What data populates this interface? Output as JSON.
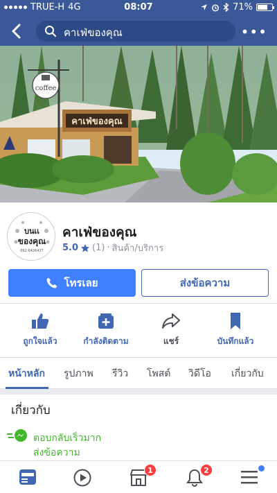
{
  "status": {
    "carrier": "TRUE-H",
    "network": "4G",
    "time": "08:07",
    "battery_percent": "71%",
    "battery_level": 0.71
  },
  "header": {
    "search_text": "คาเฟ่ของคุณ",
    "more_label": "•••"
  },
  "cover": {
    "sign_text": "คาเฟ่ของคุณ",
    "logo_text": "coffee"
  },
  "page": {
    "name": "คาเฟ่ของคุณ",
    "rating": "5.0",
    "rating_count": "(1)",
    "separator": "·",
    "category": "สินค้า/บริการ",
    "avatar_text_line1": "บนเเ",
    "avatar_text_line2": "ของคุณ",
    "avatar_phone": "062 6426437"
  },
  "buttons": {
    "call": "โทรเลย",
    "message": "ส่งข้อความ"
  },
  "actions": [
    {
      "label": "ถูกใจแล้ว",
      "icon": "thumbs-up-icon"
    },
    {
      "label": "กำลังติดตาม",
      "icon": "following-icon"
    },
    {
      "label": "แชร์",
      "icon": "share-icon"
    },
    {
      "label": "บันทึกแล้ว",
      "icon": "bookmark-icon"
    }
  ],
  "tabs": [
    {
      "label": "หน้าหลัก",
      "active": true
    },
    {
      "label": "รูปภาพ",
      "active": false
    },
    {
      "label": "รีวิว",
      "active": false
    },
    {
      "label": "โพสต์",
      "active": false
    },
    {
      "label": "วิดีโอ",
      "active": false
    },
    {
      "label": "เกี่ยวกับ",
      "active": false
    }
  ],
  "about": {
    "title": "เกี่ยวกับ",
    "response_line1": "ตอบกลับเร็วมาก",
    "response_line2": "ส่งข้อความ"
  },
  "bottom_nav": {
    "marketplace_badge": "1",
    "notifications_badge": "2"
  },
  "colors": {
    "brand": "#3b5998",
    "accent": "#4267b2",
    "button": "#4080ff",
    "green": "#42b72a",
    "badge": "#fa3e3e"
  }
}
